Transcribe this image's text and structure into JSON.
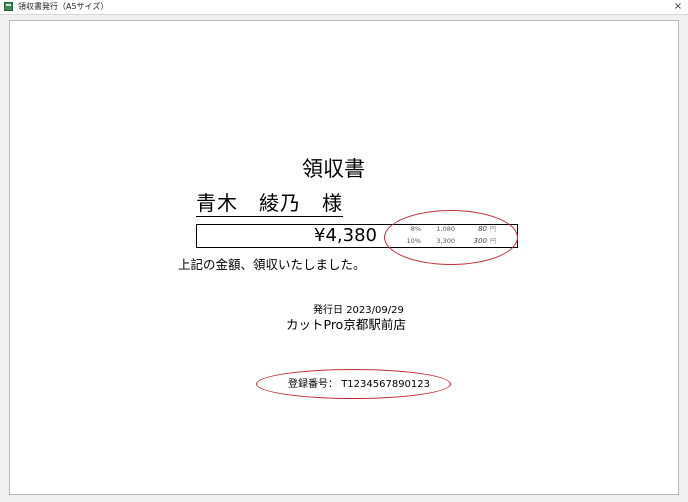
{
  "window": {
    "title": "領収書発行（A5サイズ）",
    "close_glyph": "×"
  },
  "receipt": {
    "title": "領収書",
    "recipient": "青木　綾乃　様",
    "amount": "¥4,380",
    "tax_breakdown": [
      {
        "rate": "8%",
        "total": "1,080",
        "tax": "80",
        "unit": "円"
      },
      {
        "rate": "10%",
        "total": "3,300",
        "tax": "300",
        "unit": "円"
      }
    ],
    "thanks": "上記の金額、領収いたしました。",
    "issue_date_label": "発行日",
    "issue_date": "2023/09/29",
    "shop_name": "カットPro京都駅前店",
    "registration_label": "登録番号：",
    "registration_number": "T1234567890123"
  },
  "annotation_color": "#c0303a"
}
